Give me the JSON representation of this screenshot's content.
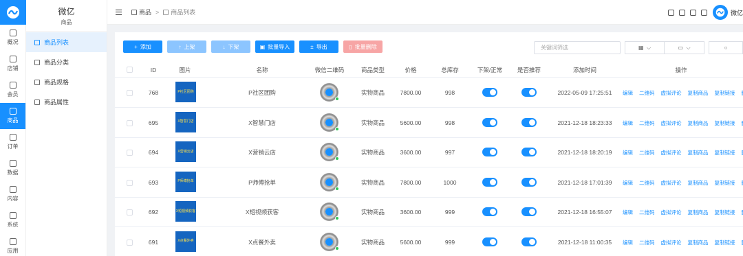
{
  "rail": {
    "items": [
      {
        "label": "概况",
        "icon": "dashboard-icon",
        "active": false
      },
      {
        "label": "店铺",
        "icon": "store-icon",
        "active": false
      },
      {
        "label": "会员",
        "icon": "member-icon",
        "active": false
      },
      {
        "label": "商品",
        "icon": "product-icon",
        "active": true
      },
      {
        "label": "订单",
        "icon": "order-icon",
        "active": false
      },
      {
        "label": "数据",
        "icon": "chart-icon",
        "active": false
      },
      {
        "label": "内容",
        "icon": "content-icon",
        "active": false
      },
      {
        "label": "系统",
        "icon": "settings-icon",
        "active": false
      },
      {
        "label": "应用",
        "icon": "apps-icon",
        "active": false
      }
    ]
  },
  "menu": {
    "title": "微亿",
    "subtitle": "商品",
    "items": [
      {
        "label": "商品列表",
        "active": true
      },
      {
        "label": "商品分类",
        "active": false
      },
      {
        "label": "商品规格",
        "active": false
      },
      {
        "label": "商品属性",
        "active": false
      }
    ]
  },
  "header": {
    "breadcrumb": [
      "商品",
      "商品列表"
    ],
    "separator": ">",
    "username": "微亿"
  },
  "toolbar": {
    "add": "添加",
    "on_shelf": "上架",
    "off_shelf": "下架",
    "batch_import": "批量导入",
    "export": "导出",
    "batch_delete": "批量删除",
    "search_placeholder": "关键词筛选"
  },
  "table": {
    "headers": [
      "ID",
      "图片",
      "名称",
      "微信二维码",
      "商品类型",
      "价格",
      "总库存",
      "下架/正常",
      "是否推荐",
      "添加时间",
      "操作"
    ],
    "actions": [
      "编辑",
      "二维码",
      "虚拟评论",
      "复制商品",
      "复制链接",
      "删除"
    ],
    "rows": [
      {
        "id": "768",
        "thumb": "P社区团购",
        "name": "P社区团购",
        "type": "实物商品",
        "price": "7800.00",
        "stock": "998",
        "on_sale": true,
        "recommend": true,
        "time": "2022-05-09 17:25:51"
      },
      {
        "id": "695",
        "thumb": "X智慧门店",
        "name": "X智慧门店",
        "type": "实物商品",
        "price": "5600.00",
        "stock": "998",
        "on_sale": true,
        "recommend": true,
        "time": "2021-12-18 18:23:33"
      },
      {
        "id": "694",
        "thumb": "X营销云店",
        "name": "X营销云店",
        "type": "实物商品",
        "price": "3600.00",
        "stock": "997",
        "on_sale": true,
        "recommend": true,
        "time": "2021-12-18 18:20:19"
      },
      {
        "id": "693",
        "thumb": "P师傅抢单",
        "name": "P师傅抢单",
        "type": "实物商品",
        "price": "7800.00",
        "stock": "1000",
        "on_sale": true,
        "recommend": true,
        "time": "2021-12-18 17:01:39"
      },
      {
        "id": "692",
        "thumb": "X短视频获客",
        "name": "X短视频获客",
        "type": "实物商品",
        "price": "3600.00",
        "stock": "999",
        "on_sale": true,
        "recommend": true,
        "time": "2021-12-18 16:55:07"
      },
      {
        "id": "691",
        "thumb": "X点餐外卖",
        "name": "X点餐外卖",
        "type": "实物商品",
        "price": "5600.00",
        "stock": "999",
        "on_sale": true,
        "recommend": true,
        "time": "2021-12-18 11:00:35"
      }
    ]
  },
  "colors": {
    "primary": "#1890ff",
    "disabled_primary": "#8cc5ff",
    "danger_disabled": "#f7a5a5",
    "thumb_bg": "#1565c0",
    "thumb_text": "#ffe24a"
  }
}
